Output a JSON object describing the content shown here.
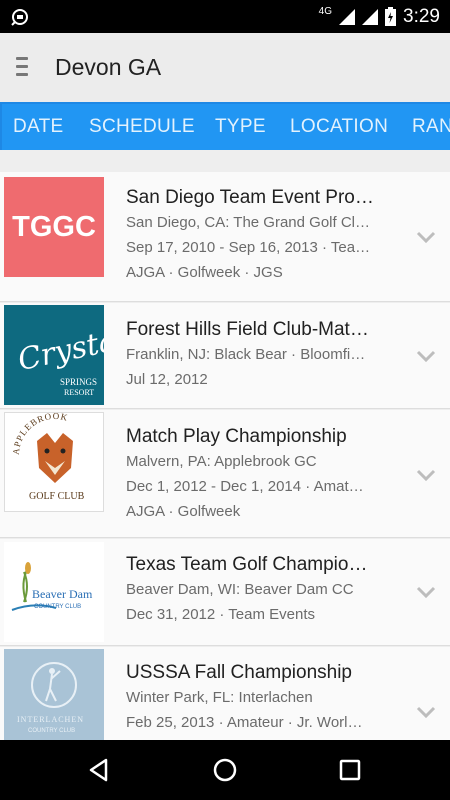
{
  "status": {
    "time": "3:29",
    "network": "4G"
  },
  "app": {
    "title": "Devon GA"
  },
  "tabs": [
    {
      "label": "DATE"
    },
    {
      "label": "SCHEDULE"
    },
    {
      "label": "TYPE"
    },
    {
      "label": "LOCATION"
    },
    {
      "label": "RAN"
    }
  ],
  "events": [
    {
      "logo_text": "TGGC",
      "logo_color": "#ef6b6f",
      "title": "San Diego Team Event Pro…",
      "location": "San Diego, CA: The Grand Golf Cl…",
      "dates": "Sep 17, 2010 - Sep 16, 2013 · Tea…",
      "tags": "AJGA · Golfweek · JGS"
    },
    {
      "logo_text": "Crystal SPRINGS RESORT",
      "logo_color": "#0e6a80",
      "title": "Forest Hills Field Club-Mat…",
      "location": "Franklin, NJ: Black Bear · Bloomfi…",
      "dates": "Jul 12, 2012",
      "tags": ""
    },
    {
      "logo_text": "APPLEBROOK GOLF CLUB",
      "logo_color": "#ffffff",
      "title": "Match Play Championship",
      "location": "Malvern, PA: Applebrook GC",
      "dates": "Dec 1, 2012 - Dec 1, 2014 · Amat…",
      "tags": "AJGA · Golfweek"
    },
    {
      "logo_text": "Beaver Dam COUNTRY CLUB",
      "logo_color": "#ffffff",
      "title": "Texas Team Golf Champio…",
      "location": "Beaver Dam, WI: Beaver Dam CC",
      "dates": "Dec 31, 2012 · Team Events",
      "tags": ""
    },
    {
      "logo_text": "INTERLACHEN COUNTRY CLUB",
      "logo_color": "#a9c3d6",
      "title": "USSSA Fall Championship",
      "location": "Winter Park, FL: Interlachen",
      "dates": "Feb 25, 2013 · Amateur · Jr. Worl…",
      "tags": ""
    }
  ]
}
